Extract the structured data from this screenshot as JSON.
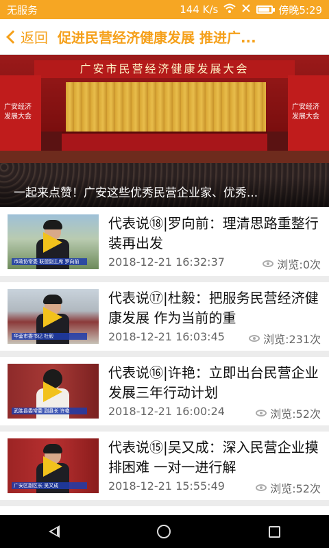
{
  "status_bar": {
    "carrier": "无服务",
    "speed": "144 K/s",
    "time": "傍晚5:29"
  },
  "header": {
    "back_label": "返回",
    "title": "促进民营经济健康发展 推进广..."
  },
  "hero": {
    "banner_text": "广安市民营经济健康发展大会",
    "side_text": "广安经济发展大会",
    "caption": "一起来点赞！广安这些优秀民营企业家、优秀..."
  },
  "news": [
    {
      "title": "代表说⑱|罗向前：理清思路重整行装再出发",
      "date": "2018-12-21 16:32:37",
      "views": "浏览:0次",
      "thumb_caption": "市政协常委 联盟副主席 罗向前"
    },
    {
      "title": "代表说⑰|杜毅：把服务民营经济健康发展 作为当前的重",
      "date": "2018-12-21 16:03:45",
      "views": "浏览:231次",
      "thumb_caption": "华蓥市委书记 杜毅"
    },
    {
      "title": "代表说⑯|许艳：立即出台民营企业发展三年行动计划",
      "date": "2018-12-21 16:00:24",
      "views": "浏览:52次",
      "thumb_caption": "武胜县委常委 副县长 许艳"
    },
    {
      "title": "代表说⑮|吴又成：深入民营企业摸排困难 一对一进行解",
      "date": "2018-12-21 15:55:49",
      "views": "浏览:52次",
      "thumb_caption": "广安区副区长 吴又成"
    }
  ],
  "colors": {
    "accent": "#f5a01a",
    "status_bar": "#f6a623",
    "play": "#f2c21c"
  }
}
